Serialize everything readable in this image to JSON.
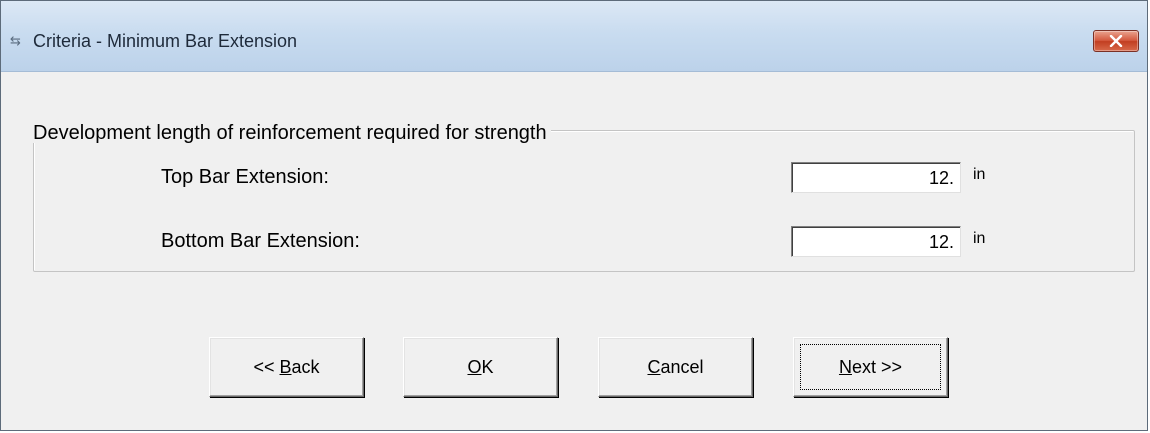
{
  "window": {
    "title": "Criteria - Minimum Bar Extension",
    "icon": "app-icon",
    "close_icon": "close-icon"
  },
  "group": {
    "legend": "Development length of reinforcement required for strength",
    "fields": [
      {
        "label": "Top Bar Extension:",
        "value": "12.",
        "unit": "in"
      },
      {
        "label": "Bottom Bar Extension:",
        "value": "12.",
        "unit": "in"
      }
    ]
  },
  "buttons": {
    "back": {
      "prefix": "<< ",
      "mnemonic": "B",
      "rest": "ack"
    },
    "ok": {
      "prefix": "",
      "mnemonic": "O",
      "rest": "K"
    },
    "cancel": {
      "prefix": "",
      "mnemonic": "C",
      "rest": "ancel"
    },
    "next": {
      "prefix": "",
      "mnemonic": "N",
      "rest": "ext >>"
    }
  }
}
